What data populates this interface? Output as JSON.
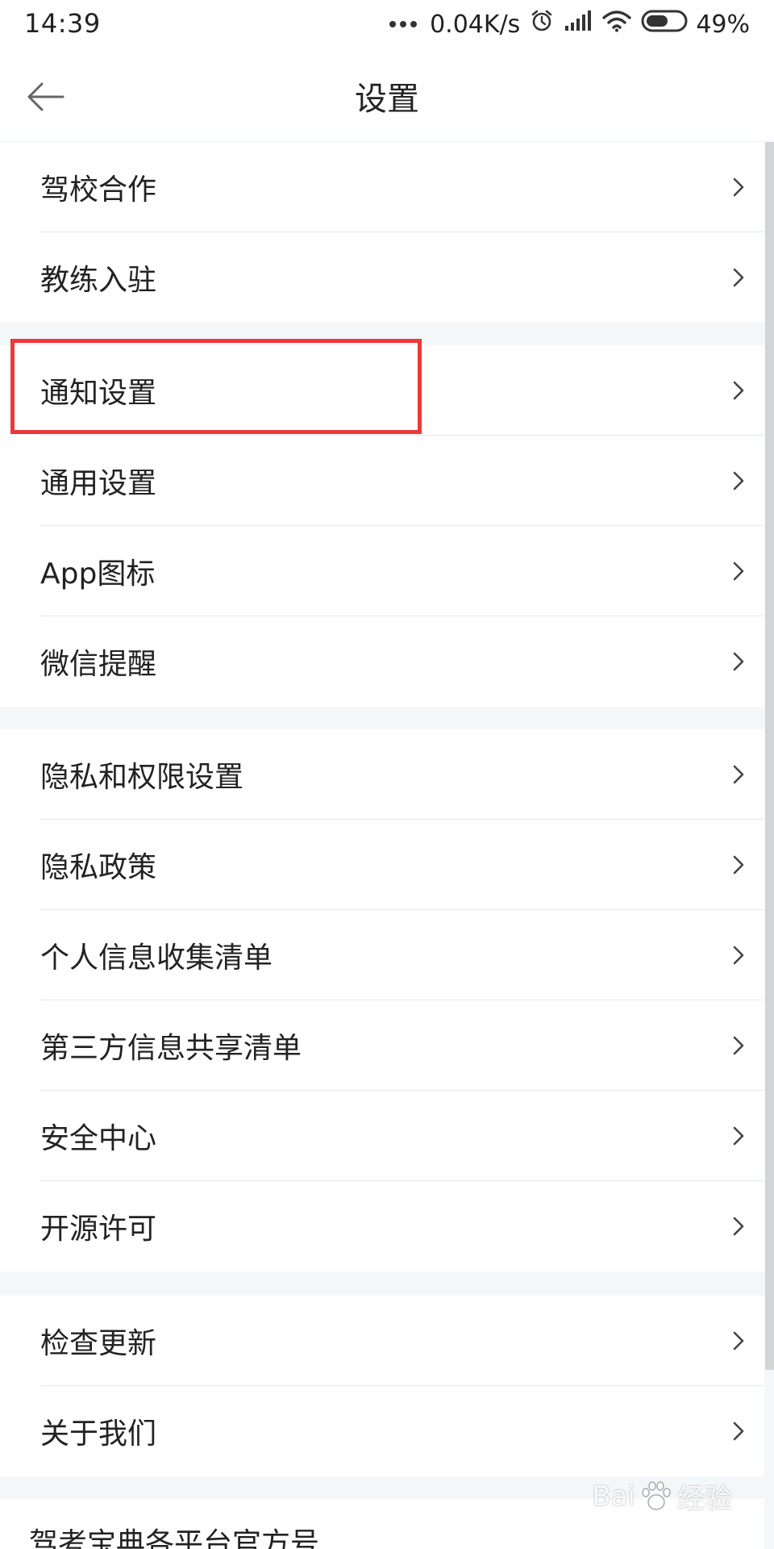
{
  "status_bar": {
    "time": "14:39",
    "network_speed": "0.04K/s",
    "battery": "49%"
  },
  "header": {
    "title": "设置",
    "back_icon": "back-arrow-icon"
  },
  "menu_items": [
    "驾校合作",
    "教练入驻",
    "通知设置",
    "通用设置",
    "App图标",
    "微信提醒",
    "隐私和权限设置",
    "隐私政策",
    "个人信息收集清单",
    "第三方信息共享清单",
    "安全中心",
    "开源许可",
    "检查更新",
    "关于我们"
  ],
  "footer_partial_text": "驾考宝典各平台官方号",
  "highlighted_item": "通知设置",
  "colors": {
    "highlight_border": "#e83a3a",
    "background": "#f4f7fa"
  },
  "watermark": {
    "brand": "Bai",
    "suffix": "经验",
    "url": "jingyan.baidu.com"
  }
}
